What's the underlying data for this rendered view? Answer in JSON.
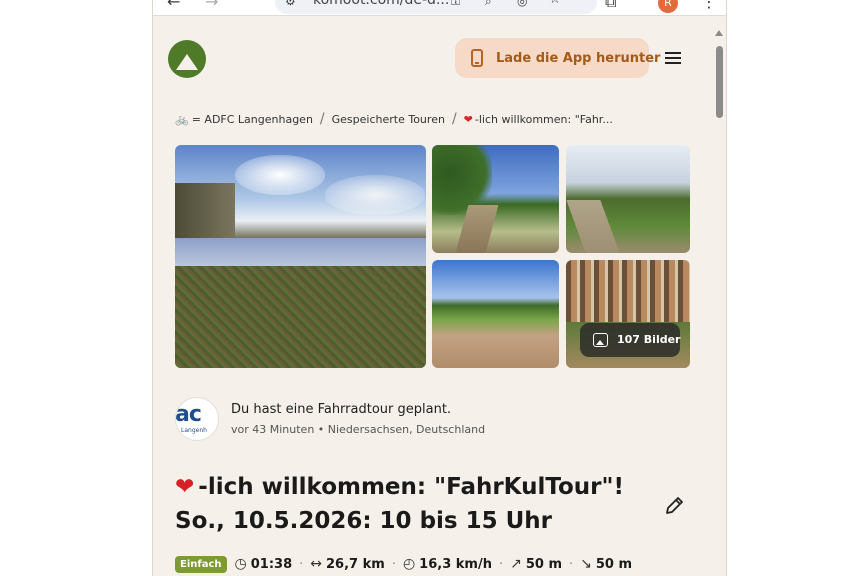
{
  "browser": {
    "url": "komoot.com/de-d...",
    "profile_initial": "R"
  },
  "header": {
    "app_button_label": "Lade die App herunter"
  },
  "breadcrumb": {
    "items": [
      "= ADFC Langenhagen",
      "Gespeicherte Touren",
      "-lich willkommen: \"Fahr..."
    ]
  },
  "gallery": {
    "count_label": "107 Bilder"
  },
  "activity": {
    "org_logo_text": "ac",
    "org_logo_subtext": "Langenh",
    "title": "Du hast eine Fahrradtour geplant.",
    "meta": "vor 43 Minuten • Niedersachsen, Deutschland"
  },
  "tour": {
    "title_line1": "-lich willkommen: \"FahrKulTour\"!",
    "title_line2": "So., 10.5.2026: 10 bis 15 Uhr"
  },
  "stats": {
    "difficulty": "Einfach",
    "duration": "01:38",
    "distance": "26,7 km",
    "speed": "16,3 km/h",
    "uphill": "50 m",
    "downhill": "50 m"
  },
  "colors": {
    "page_bg": "#f5f1ea",
    "brand_green": "#4f7a28",
    "app_button_bg": "#f7d9c8",
    "app_button_text": "#a45a18",
    "badge_bg": "#7e9a33",
    "heart": "#d81f26"
  },
  "icons": [
    "back-icon",
    "forward-icon",
    "site-info-icon",
    "key-icon",
    "zoom-icon",
    "eye-off-icon",
    "star-icon",
    "extensions-icon",
    "more-icon",
    "phone-icon",
    "menu-icon",
    "bike-icon",
    "heart-icon",
    "image-icon",
    "pencil-icon",
    "clock-icon",
    "distance-icon",
    "speed-icon",
    "uphill-icon",
    "downhill-icon"
  ]
}
